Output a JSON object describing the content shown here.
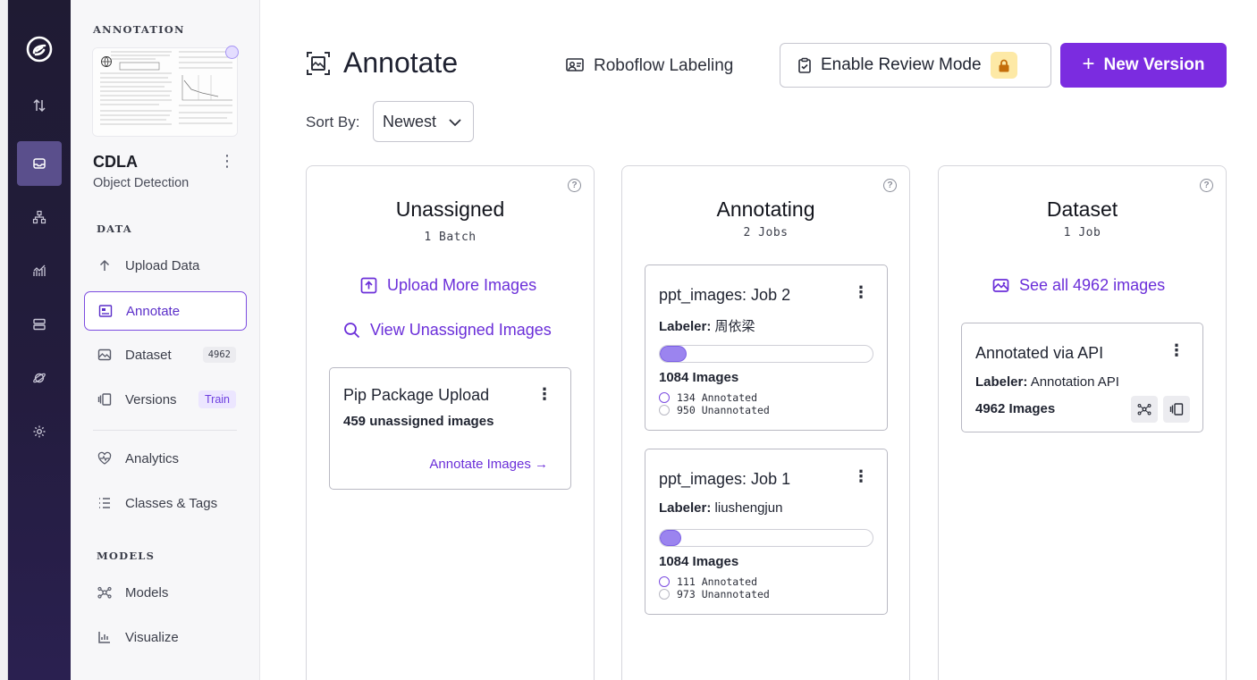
{
  "sidebar": {
    "annotation_label": "ANNOTATION",
    "project_name": "CDLA",
    "project_type": "Object Detection",
    "project_menu": "⋮",
    "data_label": "DATA",
    "models_label": "MODELS",
    "items": [
      {
        "label": "Upload Data",
        "icon": "upload-icon"
      },
      {
        "label": "Annotate",
        "icon": "annotate-icon",
        "active": true
      },
      {
        "label": "Dataset",
        "icon": "image-icon",
        "badge": "4962"
      },
      {
        "label": "Versions",
        "icon": "versions-icon",
        "badge": "Train"
      },
      {
        "label": "Analytics",
        "icon": "heart-pulse-icon"
      },
      {
        "label": "Classes & Tags",
        "icon": "list-icon"
      },
      {
        "label": "Models",
        "icon": "models-icon"
      },
      {
        "label": "Visualize",
        "icon": "chart-icon"
      }
    ]
  },
  "header": {
    "title": "Annotate",
    "roboflow_labeling": "Roboflow Labeling",
    "review_mode": "Enable Review Mode",
    "new_version": "New Version",
    "new_version_plus": "+",
    "sort_label": "Sort By:",
    "sort_value": "Newest"
  },
  "columns": {
    "unassigned": {
      "help": "?",
      "title": "Unassigned",
      "subtitle": "1 Batch",
      "upload_link": "Upload More Images",
      "view_link": "View Unassigned Images",
      "card": {
        "title": "Pip Package Upload",
        "menu": "⋮",
        "count": "459 unassigned images",
        "action": "Annotate Images →"
      }
    },
    "annotating": {
      "help": "?",
      "title": "Annotating",
      "subtitle": "2 Jobs",
      "jobs": [
        {
          "title": "ppt_images: Job 2",
          "menu": "⋮",
          "labeler_label": "Labeler:",
          "labeler": "周依梁",
          "progress": 0.124,
          "images": "1084 Images",
          "annotated": "134 Annotated",
          "unannotated": "950 Unannotated"
        },
        {
          "title": "ppt_images: Job 1",
          "menu": "⋮",
          "labeler_label": "Labeler:",
          "labeler": "liushengjun",
          "progress": 0.102,
          "images": "1084 Images",
          "annotated": "111 Annotated",
          "unannotated": "973 Unannotated"
        }
      ]
    },
    "dataset": {
      "help": "?",
      "title": "Dataset",
      "subtitle": "1 Job",
      "see_all": "See all 4962 images",
      "card": {
        "title": "Annotated via API",
        "menu": "⋮",
        "labeler_label": "Labeler:",
        "labeler": "Annotation API",
        "images": "4962 Images"
      }
    }
  },
  "colors": {
    "accent": "#7b2ce0",
    "accent_text": "#6b2fd9",
    "progress_fill": "#9b84ef",
    "rail_bg": "#231c3d"
  }
}
